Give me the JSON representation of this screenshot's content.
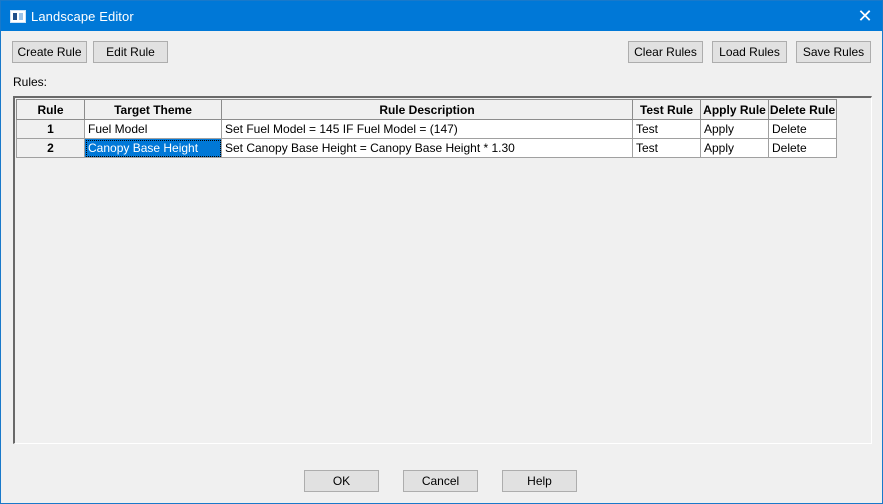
{
  "window": {
    "title": "Landscape Editor",
    "close_symbol": "✕"
  },
  "toolbar": {
    "create_rule": "Create Rule",
    "edit_rule": "Edit Rule",
    "clear_rules": "Clear Rules",
    "load_rules": "Load Rules",
    "save_rules": "Save Rules"
  },
  "rules_label": "Rules:",
  "table": {
    "headers": [
      "Rule",
      "Target Theme",
      "Rule Description",
      "Test Rule",
      "Apply Rule",
      "Delete Rule"
    ],
    "rows": [
      {
        "rule": "1",
        "target_theme": "Fuel Model",
        "description": "Set Fuel Model = 145 IF Fuel Model = (147)",
        "test": "Test",
        "apply": "Apply",
        "delete": "Delete"
      },
      {
        "rule": "2",
        "target_theme": "Canopy Base Height",
        "description": "Set Canopy Base Height = Canopy Base Height * 1.30",
        "test": "Test",
        "apply": "Apply",
        "delete": "Delete"
      }
    ]
  },
  "footer": {
    "ok": "OK",
    "cancel": "Cancel",
    "help": "Help"
  },
  "colors": {
    "titlebar": "#0078d7",
    "selection": "#0078d7"
  },
  "icons": {
    "app": "window-app-icon",
    "close": "close-icon"
  }
}
